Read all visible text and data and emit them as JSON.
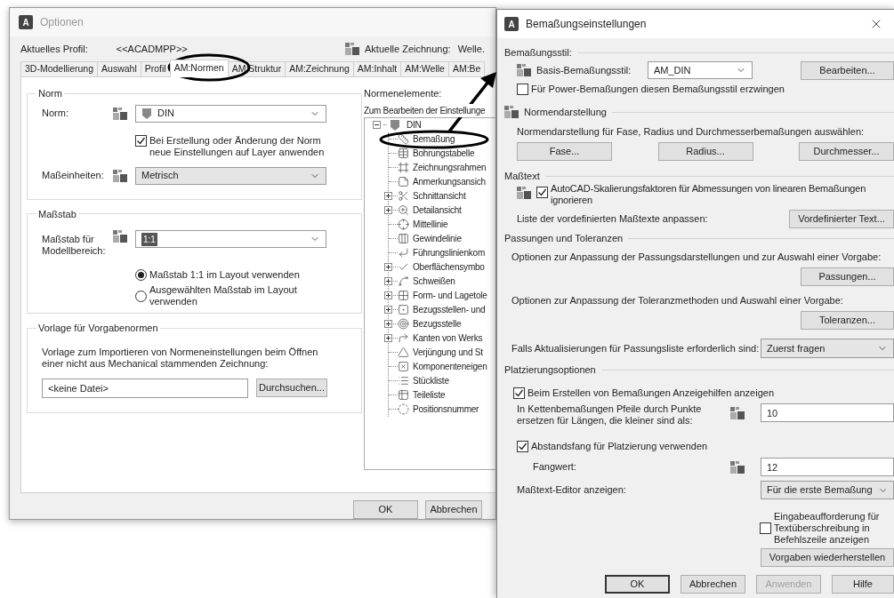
{
  "options_window": {
    "app_icon": "A",
    "title": "Optionen",
    "profile": {
      "label": "Aktuelles Profil:",
      "value": "<<ACADMPP>>"
    },
    "drawing": {
      "label": "Aktuelle Zeichnung:",
      "value": "Welle."
    },
    "tabs": [
      {
        "label": "3D-Modellierung",
        "selected": false
      },
      {
        "label": "Auswahl",
        "selected": false
      },
      {
        "label": "Profil",
        "selected": false
      },
      {
        "label": "AM:Normen",
        "selected": true
      },
      {
        "label": "AM:Struktur",
        "selected": false
      },
      {
        "label": "AM:Zeichnung",
        "selected": false
      },
      {
        "label": "AM:Inhalt",
        "selected": false
      },
      {
        "label": "AM:Welle",
        "selected": false
      },
      {
        "label": "AM:Be",
        "selected": false
      }
    ],
    "norm_group": {
      "title": "Norm",
      "norm_label": "Norm:",
      "norm_value": "DIN",
      "apply_layer": {
        "label": "Bei Erstellung oder Änderung der Norm neue Einstellungen auf Layer anwenden",
        "checked": true
      },
      "units_label": "Maßeinheiten:",
      "units_value": "Metrisch"
    },
    "scale_group": {
      "title": "Maßstab",
      "label": "Maßstab für Modellbereich:",
      "value": "1:1",
      "options": [
        {
          "label": "Maßstab 1:1 im Layout verwenden",
          "selected": true
        },
        {
          "label": "Ausgewählten Maßstab im Layout verwenden",
          "selected": false
        }
      ]
    },
    "template_group": {
      "title": "Vorlage für Vorgabenormen",
      "description": "Vorlage zum Importieren von Normeneinstellungen beim Öffnen einer nicht aus Mechanical stammenden Zeichnung:",
      "file": "<keine Datei>",
      "browse": "Durchsuchen..."
    },
    "elements": {
      "title": "Normenelemente:",
      "hint": "Zum Bearbeiten der Einstellunge",
      "tree": [
        {
          "label": "DIN",
          "expanded": true,
          "children": [
            {
              "label": "Bemaßung"
            },
            {
              "label": "Bohrungstabelle"
            },
            {
              "label": "Zeichnungsrahmen"
            },
            {
              "label": "Anmerkungsansich"
            },
            {
              "label": "Schnittansicht",
              "expanded": false
            },
            {
              "label": "Detailansicht",
              "expanded": false
            },
            {
              "label": "Mittellinie"
            },
            {
              "label": "Gewindelinie"
            },
            {
              "label": "Führungslinienkom"
            },
            {
              "label": "Oberflächensymbo",
              "expanded": false
            },
            {
              "label": "Schweißen",
              "expanded": false
            },
            {
              "label": "Form- und Lagetole",
              "expanded": false
            },
            {
              "label": "Bezugsstellen- und",
              "expanded": false
            },
            {
              "label": "Bezugsstelle",
              "expanded": false
            },
            {
              "label": "Kanten von Werks",
              "expanded": false
            },
            {
              "label": "Verjüngung und St"
            },
            {
              "label": "Komponenteneigen"
            },
            {
              "label": "Stückliste"
            },
            {
              "label": "Teileliste"
            },
            {
              "label": "Positionsnummer"
            }
          ]
        }
      ]
    },
    "buttons": [
      "OK",
      "Abbrechen"
    ]
  },
  "dimension_dialog": {
    "app_icon": "A",
    "title": "Bemaßungseinstellungen",
    "style_section": {
      "title": "Bemaßungsstil:",
      "base_label": "Basis-Bemaßungsstil:",
      "base_value": "AM_DIN",
      "edit_button": "Bearbeiten...",
      "force": {
        "label": "Für Power-Bemaßungen diesen Bemaßungsstil erzwingen",
        "checked": false
      }
    },
    "standard_section": {
      "title": "Normendarstellung",
      "description": "Normendarstellung für Fase, Radius und Durchmesserbemaßungen auswählen:",
      "buttons": [
        "Fase...",
        "Radius...",
        "Durchmesser..."
      ]
    },
    "text_section": {
      "title": "Maßtext",
      "ignore_scale": {
        "label": "AutoCAD-Skalierungsfaktoren für Abmessungen von linearen Bemaßungen ignorieren",
        "checked": true
      },
      "predefined_label": "Liste der vordefinierten Maßtexte anpassen:",
      "predefined_button": "Vordefinierter Text..."
    },
    "fits_section": {
      "title": "Passungen und Toleranzen",
      "fits_description": "Optionen zur Anpassung der Passungsdarstellungen und zur Auswahl einer Vorgabe:",
      "fits_button": "Passungen...",
      "tol_description": "Optionen zur Anpassung der Toleranzmethoden und Auswahl einer Vorgabe:",
      "tol_button": "Toleranzen...",
      "update_label": "Falls Aktualisierungen für Passungsliste erforderlich sind:",
      "update_value": "Zuerst fragen"
    },
    "placement_section": {
      "title": "Platzierungsoptionen",
      "show_helpers": {
        "label": "Beim Erstellen von Bemaßungen Anzeigehilfen anzeigen",
        "checked": true
      },
      "chain_label": "In Kettenbemaßungen Pfeile durch Punkte ersetzen für Längen, die kleiner sind als:",
      "chain_value": "10",
      "snap": {
        "label": "Abstandsfang für Platzierung verwenden",
        "checked": true
      },
      "snap_label": "Fangwert:",
      "snap_value": "12",
      "editor_label": "Maßtext-Editor anzeigen:",
      "editor_value": "Für die erste Bemaßung",
      "prompt": {
        "label": "Eingabeaufforderung für Textüberschreibung in Befehlszeile anzeigen",
        "checked": false
      },
      "restore_button": "Vorgaben wiederherstellen"
    },
    "buttons": [
      {
        "label": "OK",
        "default": true,
        "disabled": false
      },
      {
        "label": "Abbrechen",
        "default": false,
        "disabled": false
      },
      {
        "label": "Anwenden",
        "default": false,
        "disabled": true
      },
      {
        "label": "Hilfe",
        "default": false,
        "disabled": false
      }
    ]
  }
}
